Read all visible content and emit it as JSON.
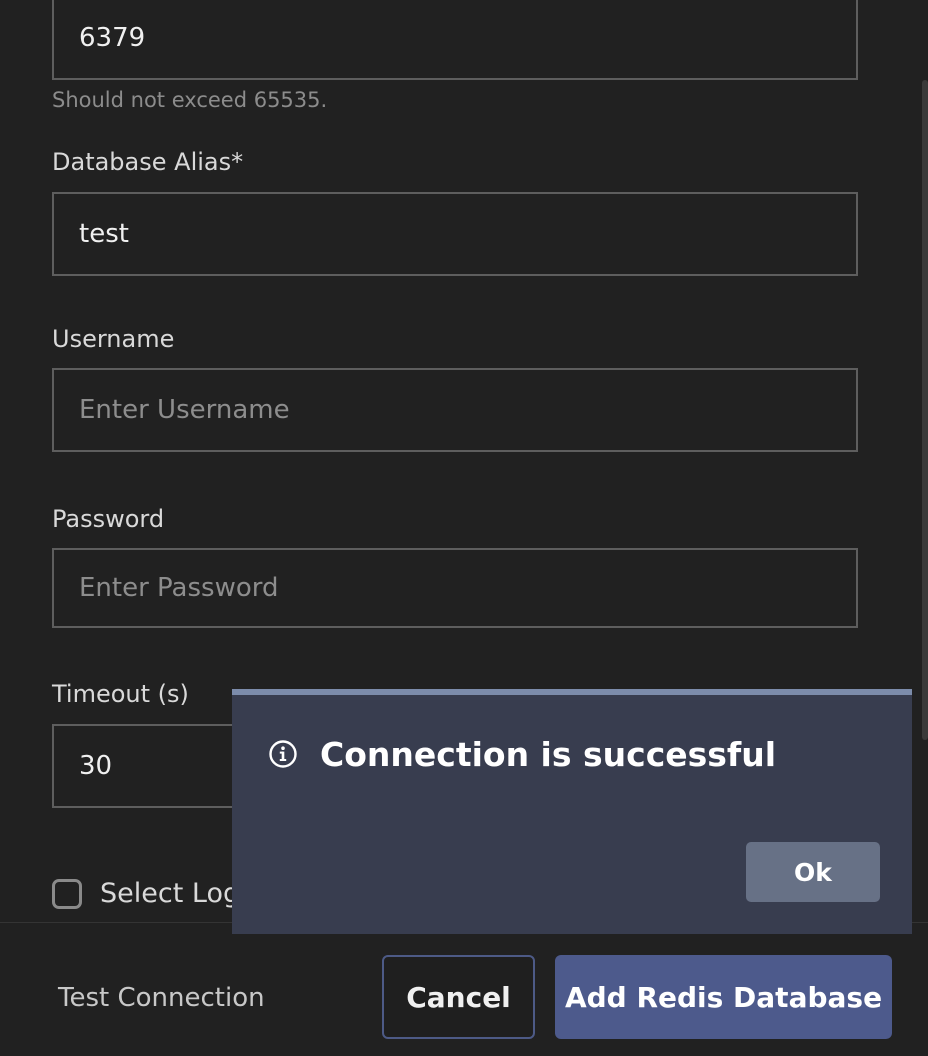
{
  "form": {
    "port": {
      "value": "6379",
      "hint": "Should not exceed 65535."
    },
    "alias": {
      "label": "Database Alias*",
      "value": "test"
    },
    "username": {
      "label": "Username",
      "placeholder": "Enter Username"
    },
    "password": {
      "label": "Password",
      "placeholder": "Enter Password"
    },
    "timeout": {
      "label": "Timeout (s)",
      "value": "30"
    },
    "logical_db": {
      "label": "Select Log",
      "checked": false
    }
  },
  "footer": {
    "test_connection": "Test Connection",
    "cancel": "Cancel",
    "add": "Add Redis Database"
  },
  "toast": {
    "icon": "info-icon",
    "message": "Connection is successful",
    "ok": "Ok"
  }
}
